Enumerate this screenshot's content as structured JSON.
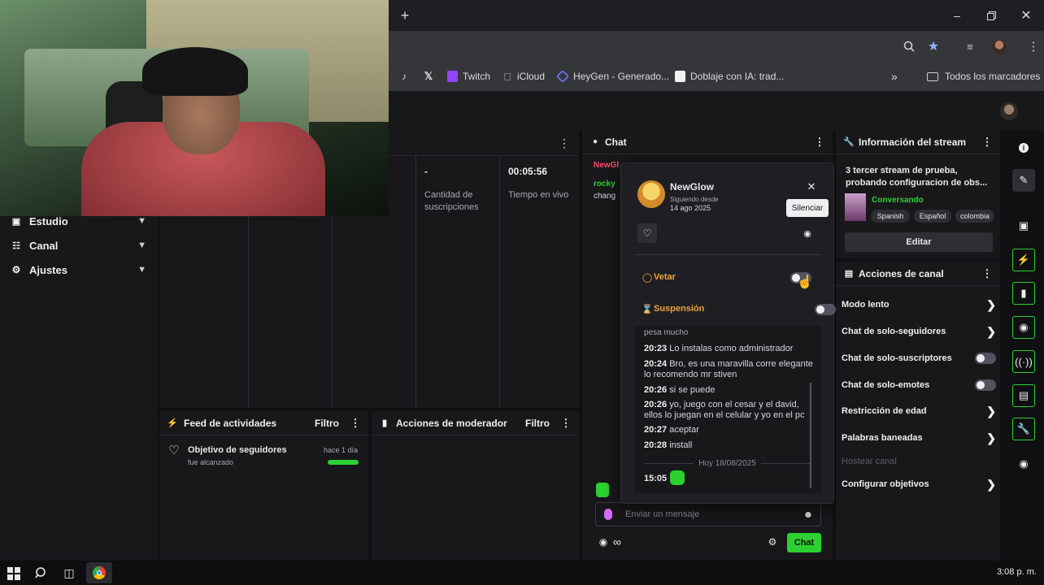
{
  "browser": {
    "new_tab_icon": "plus-icon",
    "window_controls": [
      "minimize-icon",
      "restore-icon",
      "close-icon"
    ],
    "bookmarks": [
      {
        "label": "",
        "icon": "tiktok-icon"
      },
      {
        "label": "",
        "icon": "x-icon"
      },
      {
        "label": "Twitch",
        "icon": "twitch-icon"
      },
      {
        "label": "iCloud",
        "icon": "apple-icon"
      },
      {
        "label": "HeyGen - Generado...",
        "icon": "heygen-icon"
      },
      {
        "label": "Doblaje con IA: trad...",
        "icon": "page-icon"
      }
    ],
    "all_bookmarks_label": "Todos los marcadores"
  },
  "nav": {
    "items": [
      {
        "label": "Estudio",
        "icon": "studio-icon"
      },
      {
        "label": "Canal",
        "icon": "channel-icon"
      },
      {
        "label": "Ajustes",
        "icon": "gear-icon"
      }
    ]
  },
  "stats": [
    {
      "value": "-",
      "label": "Cantidad de suscripciones"
    },
    {
      "value": "00:05:56",
      "label": "Tiempo en vivo"
    }
  ],
  "feed": {
    "title": "Feed de actividades",
    "filter": "Filtro",
    "item_title": "Objetivo de seguidores",
    "item_sub": "fue alcanzado",
    "item_time": "hace 1 día",
    "goal_progress": 1.0
  },
  "modactions": {
    "title": "Acciones de moderador",
    "filter": "Filtro"
  },
  "chat": {
    "title": "Chat",
    "visible_users": [
      "NewGl",
      "rocky"
    ],
    "visible_fragment": "chang",
    "input_placeholder": "Enviar un mensaje",
    "send_label": "Chat"
  },
  "card": {
    "username": "NewGlow",
    "following_since_label": "Siguiendo desde",
    "following_since_date": "14 ago 2025",
    "tooltip": "Silenciar",
    "ban_label": "Vetar",
    "suspend_label": "Suspensión",
    "partial_line": "pesa mucho",
    "messages": [
      {
        "time": "20:23",
        "text": "Lo instalas como administrador"
      },
      {
        "time": "20:24",
        "text": "Bro, es una maravilla corre elegante lo recomendo mr stiven"
      },
      {
        "time": "20:26",
        "text": "si se puede"
      },
      {
        "time": "20:26",
        "text": "yo, juego con el cesar y el david, ellos lo juegan en el celular y yo en el pc"
      },
      {
        "time": "20:27",
        "text": "aceptar"
      },
      {
        "time": "20:28",
        "text": "install"
      }
    ],
    "date_divider": "Hoy 18/08/2025",
    "last_time": "15:05"
  },
  "stream_info": {
    "title": "Información del stream",
    "stream_title": "3 tercer stream de prueba, probando configuracion de obs...",
    "category": "Conversando",
    "tags": [
      "Spanish",
      "Español",
      "colombia"
    ],
    "edit_label": "Editar"
  },
  "channel_actions": {
    "title": "Acciones de canal",
    "items": [
      {
        "label": "Modo lento",
        "control": "chevron"
      },
      {
        "label": "Chat de solo-seguidores",
        "control": "chevron"
      },
      {
        "label": "Chat de solo-suscriptores",
        "control": "toggle"
      },
      {
        "label": "Chat de solo-emotes",
        "control": "toggle"
      },
      {
        "label": "Restricción de edad",
        "control": "chevron"
      },
      {
        "label": "Palabras baneadas",
        "control": "chevron"
      },
      {
        "label": "Hostear canal",
        "control": "disabled"
      },
      {
        "label": "Configurar objetivos",
        "control": "chevron"
      }
    ]
  },
  "taskbar": {
    "time": "3:08 p. m."
  },
  "colors": {
    "accent_green": "#2bd130",
    "ban_orange": "#f0a23a",
    "twitch_purple": "#9146ff"
  }
}
